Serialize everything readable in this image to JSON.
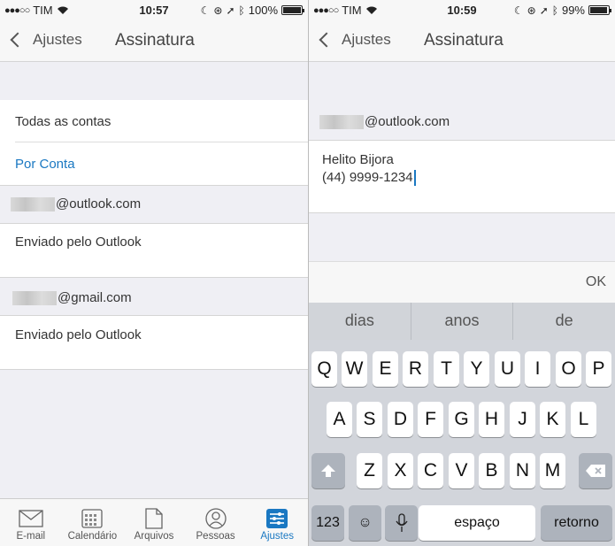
{
  "left": {
    "status": {
      "carrier": "TIM",
      "time": "10:57",
      "battery": "100%"
    },
    "nav": {
      "back_label": "Ajustes",
      "title": "Assinatura"
    },
    "options": {
      "all_accounts": "Todas as contas",
      "per_account": "Por Conta"
    },
    "accounts": [
      {
        "email_suffix": "@outlook.com",
        "signature": "Enviado pelo Outlook"
      },
      {
        "email_suffix": "@gmail.com",
        "signature": "Enviado pelo Outlook"
      }
    ],
    "tabs": [
      {
        "label": "E-mail",
        "icon": "mail-icon"
      },
      {
        "label": "Calendário",
        "icon": "calendar-icon"
      },
      {
        "label": "Arquivos",
        "icon": "file-icon"
      },
      {
        "label": "Pessoas",
        "icon": "people-icon"
      },
      {
        "label": "Ajustes",
        "icon": "settings-icon",
        "active": true
      }
    ],
    "accent_color": "#1a78c2"
  },
  "right": {
    "status": {
      "carrier": "TIM",
      "time": "10:59",
      "battery": "99%"
    },
    "nav": {
      "back_label": "Ajustes",
      "title": "Assinatura"
    },
    "account_email_suffix": "@outlook.com",
    "signature_lines": [
      "Helito Bijora",
      "(44) 9999-1234"
    ],
    "ok_label": "OK",
    "suggestions": [
      "dias",
      "anos",
      "de"
    ],
    "keyboard": {
      "row1": [
        "Q",
        "W",
        "E",
        "R",
        "T",
        "Y",
        "U",
        "I",
        "O",
        "P"
      ],
      "row2": [
        "A",
        "S",
        "D",
        "F",
        "G",
        "H",
        "J",
        "K",
        "L"
      ],
      "row3": [
        "Z",
        "X",
        "C",
        "V",
        "B",
        "N",
        "M"
      ],
      "numbers_label": "123",
      "space_label": "espaço",
      "return_label": "retorno"
    }
  }
}
